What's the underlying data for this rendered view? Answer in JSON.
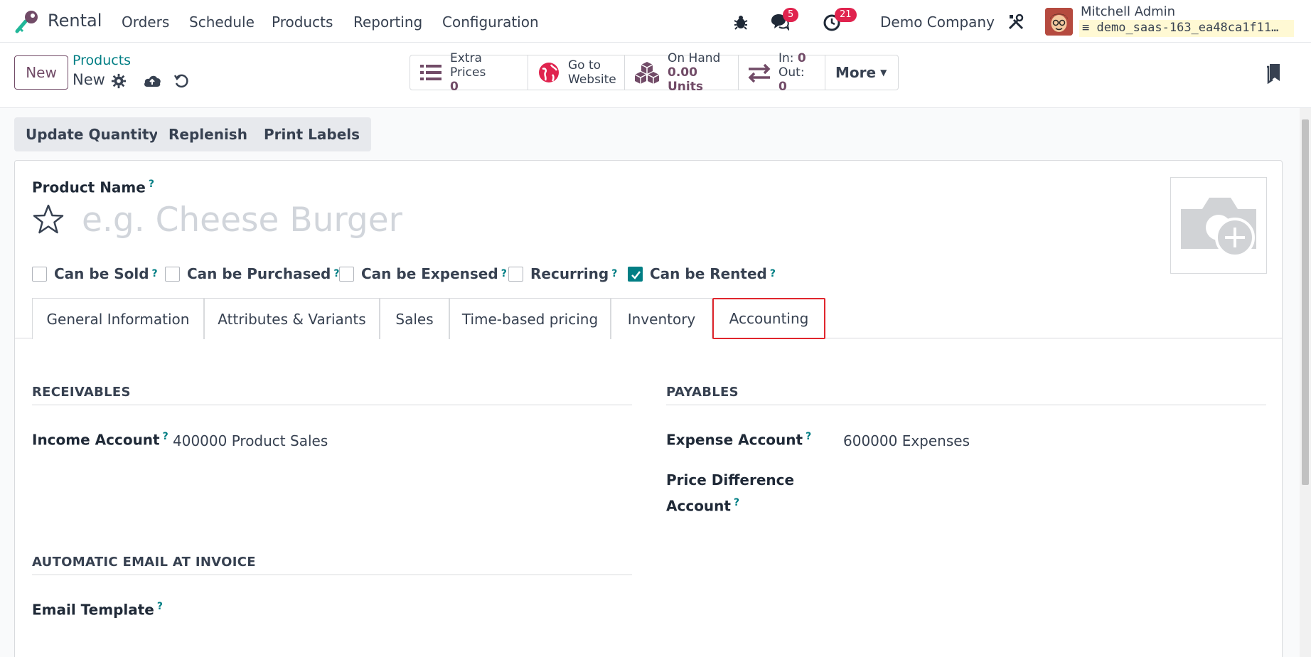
{
  "navbar": {
    "app_name": "Rental",
    "menus": [
      "Orders",
      "Schedule",
      "Products",
      "Reporting",
      "Configuration"
    ],
    "messages_count": "5",
    "activities_count": "21",
    "company": "Demo Company",
    "user_name": "Mitchell Admin",
    "database": "demo_saas-163_ea48ca1f11…"
  },
  "control": {
    "new_label": "New",
    "breadcrumb_parent": "Products",
    "breadcrumb_current": "New",
    "stats": {
      "extra_prices_label": "Extra Prices",
      "extra_prices_value": "0",
      "website_line1": "Go to",
      "website_line2": "Website",
      "on_hand_label": "On Hand",
      "on_hand_value": "0.00 Units",
      "in_label": "In:",
      "in_value": "0",
      "out_label": "Out:",
      "out_value": "0",
      "more_label": "More"
    }
  },
  "actions": [
    "Update Quantity",
    "Replenish",
    "Print Labels"
  ],
  "form": {
    "product_name_label": "Product Name",
    "product_name_placeholder": "e.g. Cheese Burger",
    "help_mark": "?",
    "checkboxes": [
      {
        "label": "Can be Sold",
        "checked": false
      },
      {
        "label": "Can be Purchased",
        "checked": false
      },
      {
        "label": "Can be Expensed",
        "checked": false
      },
      {
        "label": "Recurring",
        "checked": false
      },
      {
        "label": "Can be Rented",
        "checked": true
      }
    ],
    "tabs": [
      "General Information",
      "Attributes & Variants",
      "Sales",
      "Time-based pricing",
      "Inventory",
      "Accounting"
    ],
    "active_tab": "Accounting",
    "receivables": {
      "title": "RECEIVABLES",
      "income_account_label": "Income Account",
      "income_account_value": "400000 Product Sales"
    },
    "payables": {
      "title": "PAYABLES",
      "expense_account_label": "Expense Account",
      "expense_account_value": "600000 Expenses",
      "price_diff_label_line1": "Price Difference",
      "price_diff_label_line2": "Account"
    },
    "email_section": {
      "title": "AUTOMATIC EMAIL AT INVOICE",
      "email_template_label": "Email Template"
    }
  },
  "colors": {
    "brand": "#714b67",
    "teal": "#017e84",
    "highlight": "#e0262d",
    "badge": "#e0234e"
  }
}
